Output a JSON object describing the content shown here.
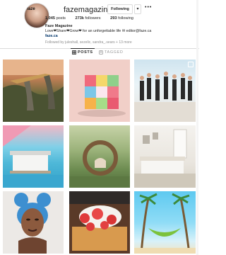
{
  "profile": {
    "username": "fazemagazine",
    "avatar_logo": "faze",
    "follow_button": "Following",
    "chevron": "▾",
    "more": "•••",
    "stats": {
      "posts_value": "1,045",
      "posts_label": "posts",
      "followers_value": "273k",
      "followers_label": "followers",
      "following_value": "293",
      "following_label": "following"
    },
    "bio_name": "Faze Magazine",
    "bio_text": "Love❤Share❤Grow❤ for an unforgettable life ✉ editor@faze.ca",
    "bio_link": "faze.ca",
    "followed_by": "Followed by juleshall, sezelic, sandra_.sears + 13 more"
  },
  "tabs": {
    "posts": "POSTS",
    "tagged": "TAGGED"
  },
  "colors": {
    "text": "#262626",
    "muted": "#8e8e8e",
    "link": "#003569",
    "border": "#dbdbdb"
  }
}
